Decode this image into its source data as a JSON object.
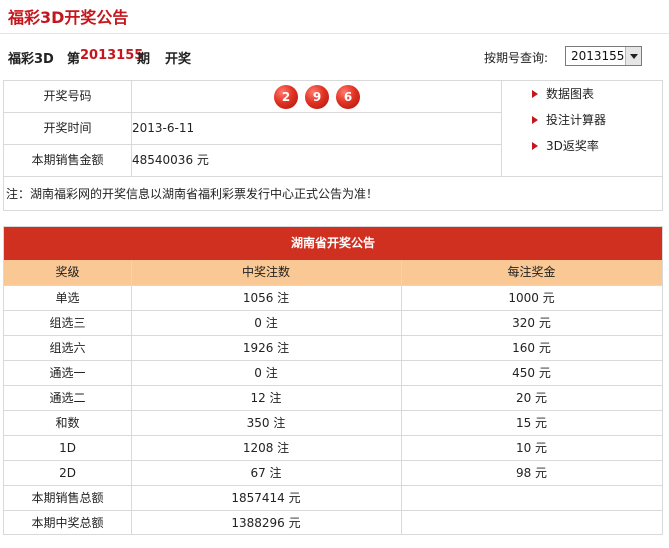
{
  "header": {
    "title": "福彩3D开奖公告"
  },
  "issue": {
    "lottery": "福彩3D",
    "prefix": "第",
    "number": "2013155",
    "suffix": "期",
    "draw_word": "开奖",
    "query_label": "按期号查询:",
    "selected": "2013155"
  },
  "info": {
    "rows": [
      {
        "label": "开奖号码",
        "value": ""
      },
      {
        "label": "开奖时间",
        "value": "2013-6-11"
      },
      {
        "label": "本期销售金额",
        "value": "48540036 元"
      }
    ],
    "balls": [
      "2",
      "9",
      "6"
    ],
    "ball_color": "#e23323",
    "links": [
      "数据图表",
      "投注计算器",
      "3D返奖率"
    ]
  },
  "note": "注：湖南福彩网的开奖信息以湖南省福利彩票发行中心正式公告为准！",
  "result_table": {
    "title": "湖南省开奖公告",
    "columns": [
      "奖级",
      "中奖注数",
      "每注奖金"
    ],
    "rows": [
      [
        "单选",
        "1056 注",
        "1000 元"
      ],
      [
        "组选三",
        "0 注",
        "320 元"
      ],
      [
        "组选六",
        "1926 注",
        "160 元"
      ],
      [
        "通选一",
        "0 注",
        "450 元"
      ],
      [
        "通选二",
        "12 注",
        "20 元"
      ],
      [
        "和数",
        "350 注",
        "15 元"
      ],
      [
        "1D",
        "1208 注",
        "10 元"
      ],
      [
        "2D",
        "67 注",
        "98 元"
      ],
      [
        "本期销售总额",
        "1857414 元",
        ""
      ],
      [
        "本期中奖总额",
        "1388296 元",
        ""
      ]
    ],
    "header_color": "#d0301f",
    "colhead_color": "#f9c894"
  }
}
